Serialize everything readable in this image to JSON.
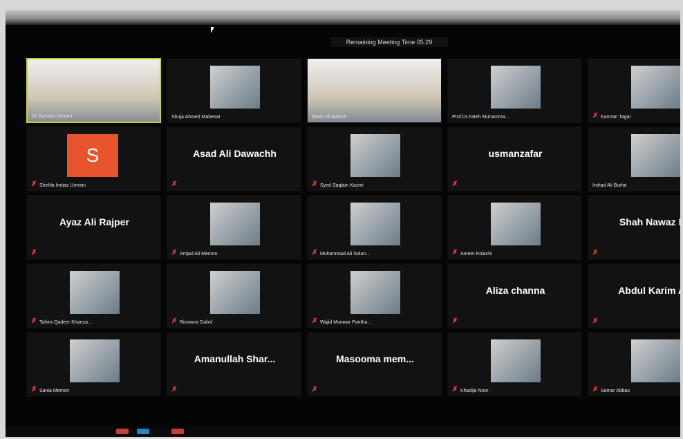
{
  "header": {
    "remaining_time": "Remaining Meeting Time 05:29"
  },
  "participants": [
    {
      "name": "Dr Sumera Umrani",
      "video": true,
      "muted": false,
      "active": true
    },
    {
      "name": "Shuja Ahmed Mahesar",
      "video": true,
      "muted": false
    },
    {
      "name": "Wazir Ali Baloch",
      "video": true,
      "muted": false
    },
    {
      "name": "Prof.Dr.Fateh Muhamma...",
      "video": true,
      "muted": false
    },
    {
      "name": "Kamran Tagar",
      "video": true,
      "muted": true
    },
    {
      "name": "Shehla Imtiaz Umrani",
      "video": false,
      "avatar": "S",
      "muted": true
    },
    {
      "name": "Asad Ali Dawachh",
      "video": false,
      "muted": true
    },
    {
      "name": "Syed Saqlain Kazmi",
      "video": true,
      "muted": true
    },
    {
      "name": "usmanzafar",
      "video": false,
      "muted": true
    },
    {
      "name": "Irshad Ali Burfat",
      "video": true,
      "muted": false
    },
    {
      "name": "Ayaz Ali Rajper",
      "video": false,
      "muted": true
    },
    {
      "name": "Amjad Ali Memon",
      "video": true,
      "muted": true
    },
    {
      "name": "Muhammad Ali Solan...",
      "video": true,
      "muted": true
    },
    {
      "name": "Ameer Kolachi",
      "video": true,
      "muted": true
    },
    {
      "name": "Shah Nawaz Ma",
      "video": false,
      "muted": true
    },
    {
      "name": "Tahira Qadeer Khanza...",
      "video": true,
      "muted": true
    },
    {
      "name": "Rizwana Gabol",
      "video": true,
      "muted": true
    },
    {
      "name": "Wajid Munwar Pantha...",
      "video": true,
      "muted": true
    },
    {
      "name": "Aliza channa",
      "video": false,
      "muted": true
    },
    {
      "name": "Abdul Karim Al..",
      "video": false,
      "muted": true
    },
    {
      "name": "Sania Memon",
      "video": true,
      "muted": true
    },
    {
      "name": "Amanullah Shar...",
      "video": false,
      "muted": true
    },
    {
      "name": "Masooma mem...",
      "video": false,
      "muted": true
    },
    {
      "name": "Khadija Noor",
      "video": true,
      "muted": true
    },
    {
      "name": "Samar Abbas",
      "video": true,
      "muted": true
    }
  ],
  "colors": {
    "active_border": "#c3d33c",
    "muted_icon": "#ff3b3b",
    "avatar_bg": "#e8542e"
  }
}
